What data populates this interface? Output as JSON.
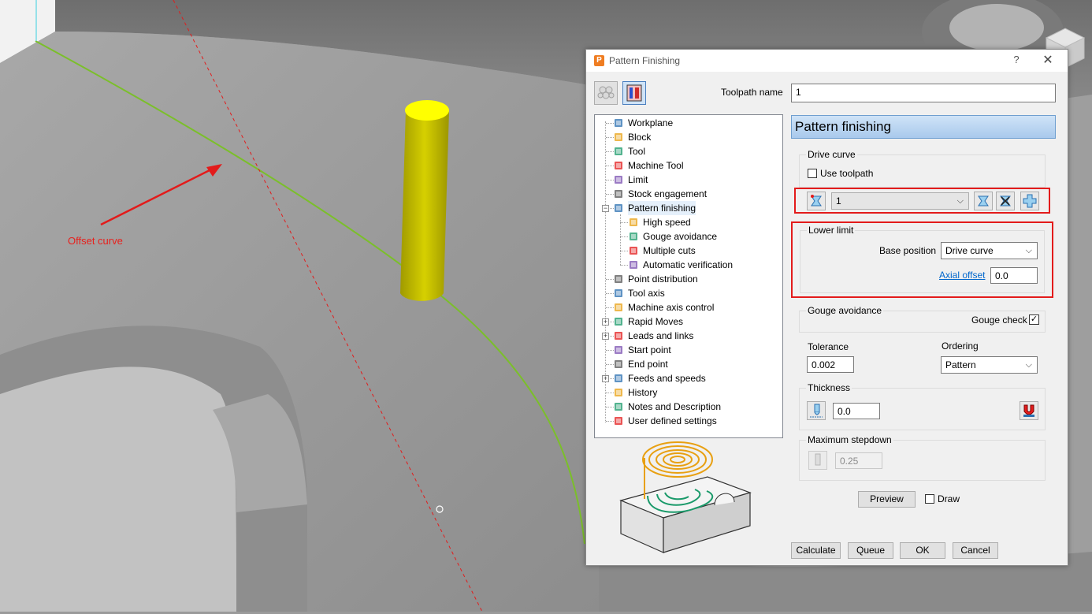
{
  "viewport": {
    "annotation_label": "Offset curve"
  },
  "dialog": {
    "title": "Pattern Finishing",
    "app_icon_letter": "P",
    "help_glyph": "?",
    "close_glyph": "✕",
    "toolpath_name_label": "Toolpath name",
    "toolpath_name_value": "1",
    "tree": {
      "items": [
        {
          "label": "Workplane",
          "icon": "workplane-icon"
        },
        {
          "label": "Block",
          "icon": "block-icon"
        },
        {
          "label": "Tool",
          "icon": "tool-icon"
        },
        {
          "label": "Machine Tool",
          "icon": "machine-tool-icon"
        },
        {
          "label": "Limit",
          "icon": "limit-icon"
        },
        {
          "label": "Stock engagement",
          "icon": "stock-engagement-icon"
        },
        {
          "label": "Pattern finishing",
          "icon": "pattern-finishing-icon",
          "expander": "−",
          "selected": true
        },
        {
          "label": "High speed",
          "icon": "high-speed-icon",
          "child": true
        },
        {
          "label": "Gouge avoidance",
          "icon": "gouge-avoidance-icon",
          "child": true
        },
        {
          "label": "Multiple cuts",
          "icon": "multiple-cuts-icon",
          "child": true
        },
        {
          "label": "Automatic verification",
          "icon": "automatic-verification-icon",
          "child": true
        },
        {
          "label": "Point distribution",
          "icon": "point-distribution-icon"
        },
        {
          "label": "Tool axis",
          "icon": "tool-axis-icon"
        },
        {
          "label": "Machine axis control",
          "icon": "machine-axis-control-icon"
        },
        {
          "label": "Rapid Moves",
          "icon": "rapid-moves-icon",
          "expander": "+"
        },
        {
          "label": "Leads and links",
          "icon": "leads-and-links-icon",
          "expander": "+"
        },
        {
          "label": "Start point",
          "icon": "start-point-icon"
        },
        {
          "label": "End point",
          "icon": "end-point-icon"
        },
        {
          "label": "Feeds and speeds",
          "icon": "feeds-and-speeds-icon",
          "expander": "+"
        },
        {
          "label": "History",
          "icon": "history-icon"
        },
        {
          "label": "Notes and Description",
          "icon": "notes-icon"
        },
        {
          "label": "User defined settings",
          "icon": "user-settings-icon"
        }
      ]
    },
    "page_header": "Pattern finishing",
    "drive_curve": {
      "group_title": "Drive curve",
      "use_toolpath_label": "Use toolpath",
      "use_toolpath_checked": false,
      "selected_value": "1"
    },
    "lower_limit": {
      "group_title": "Lower limit",
      "base_position_label": "Base position",
      "base_position_value": "Drive curve",
      "axial_offset_label": "Axial offset",
      "axial_offset_value": "0.0"
    },
    "gouge_avoidance": {
      "group_title": "Gouge avoidance",
      "gouge_check_label": "Gouge check",
      "gouge_check_checked": true,
      "check_glyph": "✓"
    },
    "tolerance": {
      "label": "Tolerance",
      "value": "0.002"
    },
    "ordering": {
      "label": "Ordering",
      "value": "Pattern"
    },
    "thickness": {
      "group_title": "Thickness",
      "value": "0.0"
    },
    "max_stepdown": {
      "group_title": "Maximum stepdown",
      "value": "0.25"
    },
    "preview_label": "Preview",
    "draw_label": "Draw",
    "draw_checked": false,
    "buttons": {
      "calculate": "Calculate",
      "queue": "Queue",
      "ok": "OK",
      "cancel": "Cancel"
    },
    "caret_glyph": "⌵"
  },
  "colors": {
    "annotation_red": "#e31b1b",
    "curve_green": "#7bbf2a",
    "pin_yellow": "#c8c200",
    "header_blue": "#a9c9ec"
  }
}
